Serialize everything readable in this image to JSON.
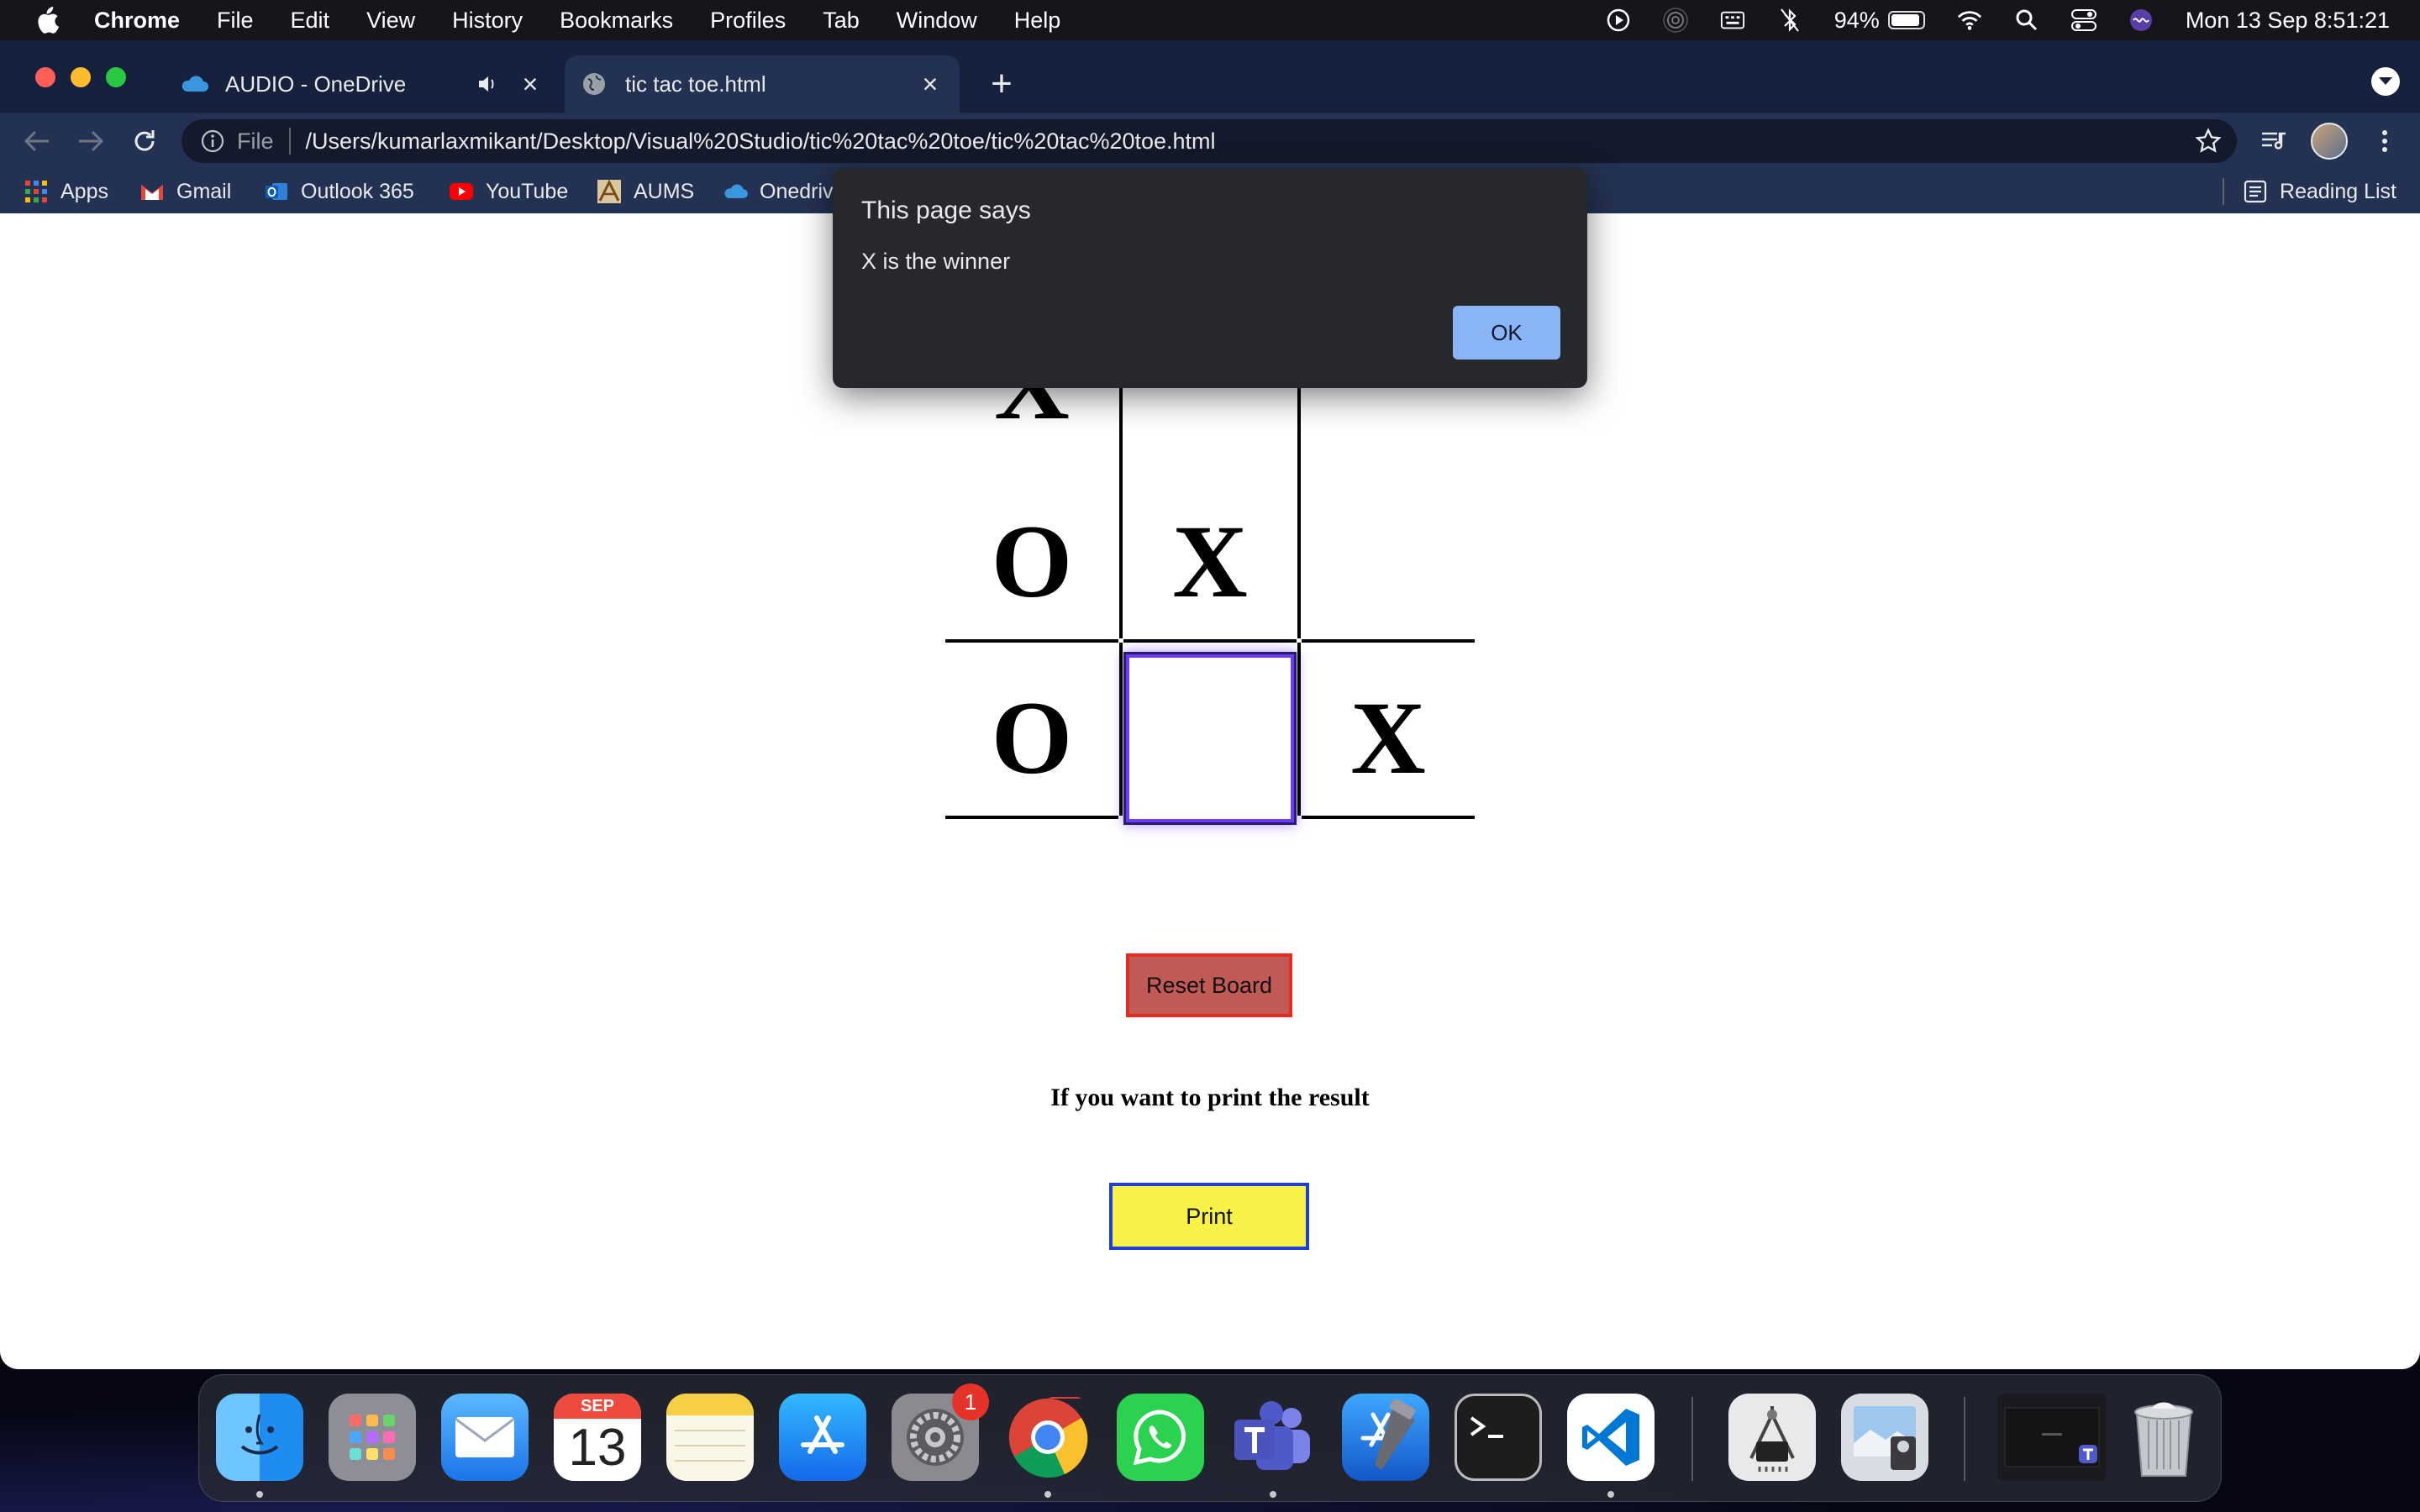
{
  "menubar": {
    "app": "Chrome",
    "items": [
      "File",
      "Edit",
      "View",
      "History",
      "Bookmarks",
      "Profiles",
      "Tab",
      "Window",
      "Help"
    ],
    "battery": "94%",
    "clock": "Mon 13 Sep  8:51:21",
    "battery_level": 0.94
  },
  "tabs": [
    {
      "title": "AUDIO - OneDrive",
      "icon": "onedrive-cloud-icon",
      "audio": true
    },
    {
      "title": "tic tac toe.html",
      "icon": "globe-icon",
      "active": true
    }
  ],
  "toolbar": {
    "scheme": "File",
    "url": "/Users/kumarlaxmikant/Desktop/Visual%20Studio/tic%20tac%20toe/tic%20tac%20toe.html"
  },
  "bookmarks": [
    {
      "label": "Apps",
      "icon": "apps-grid-icon"
    },
    {
      "label": "Gmail",
      "icon": "gmail-icon"
    },
    {
      "label": "Outlook 365",
      "icon": "outlook-icon"
    },
    {
      "label": "YouTube",
      "icon": "youtube-icon"
    },
    {
      "label": "AUMS",
      "icon": "aums-icon"
    },
    {
      "label": "Onedriv",
      "icon": "onedrive-cloud-icon"
    }
  ],
  "reading_list": "Reading List",
  "dialog": {
    "title": "This page says",
    "message": "X is the winner",
    "ok_label": "OK"
  },
  "board": {
    "cells": [
      "X",
      "",
      "",
      "O",
      "X",
      "",
      "O",
      "",
      "X"
    ],
    "focused_index": 7
  },
  "reset_label": "Reset Board",
  "print_note": "If you want to print the result",
  "print_label": "Print",
  "dock": {
    "calendar_month": "SEP",
    "calendar_day": "13",
    "settings_badge": "1",
    "apps": [
      "finder-icon",
      "launchpad-icon",
      "mail-icon",
      "calendar-icon",
      "notes-icon",
      "app-store-icon",
      "system-preferences-icon",
      "chrome-icon",
      "whatsapp-icon",
      "teams-icon",
      "xcode-icon",
      "terminal-icon",
      "vscode-icon",
      "digital-color-meter-icon",
      "preview-icon",
      "teams-window-icon",
      "trash-icon"
    ]
  },
  "colors": {
    "reset_bg": "#c15a55",
    "reset_border": "#e52a20",
    "print_bg": "#f7f148",
    "print_border": "#1d3fd6",
    "dialog_ok": "#8ab4f8"
  }
}
